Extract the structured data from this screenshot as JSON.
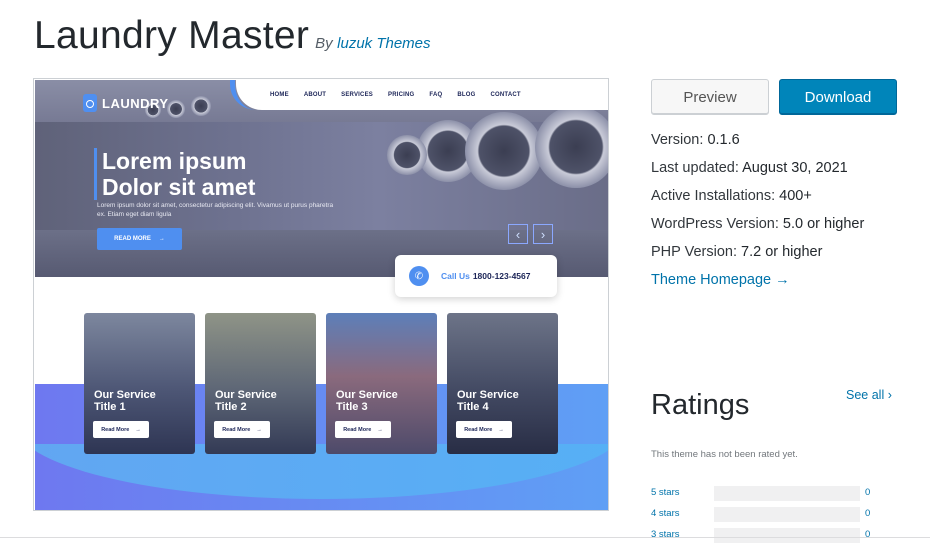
{
  "theme": {
    "name": "Laundry Master",
    "by_label": "By",
    "author": "luzuk Themes"
  },
  "screenshot": {
    "logo_text": "LAUNDRY",
    "nav": [
      "HOME",
      "ABOUT",
      "SERVICES",
      "PRICING",
      "FAQ",
      "BLOG",
      "CONTACT"
    ],
    "headline_line1": "Lorem ipsum",
    "headline_line2": "Dolor sit amet",
    "subtext": "Lorem ipsum dolor sit amet, consectetur adipiscing elit. Vivamus ut purus pharetra ex. Etiam eget diam ligula",
    "read_more": "READ MORE",
    "call_label": "Call Us",
    "call_number": "1800-123-4567",
    "services": [
      {
        "title_line1": "Our Service",
        "title_line2": "Title 1",
        "button": "Read More"
      },
      {
        "title_line1": "Our Service",
        "title_line2": "Title 2",
        "button": "Read More"
      },
      {
        "title_line1": "Our Service",
        "title_line2": "Title 3",
        "button": "Read More"
      },
      {
        "title_line1": "Our Service",
        "title_line2": "Title 4",
        "button": "Read More"
      }
    ],
    "accent_color": "#4f8ff0"
  },
  "actions": {
    "preview_label": "Preview",
    "download_label": "Download"
  },
  "meta": {
    "version_label": "Version:",
    "version_value": "0.1.6",
    "updated_label": "Last updated:",
    "updated_value": "August 30, 2021",
    "installs_label": "Active Installations:",
    "installs_value": "400+",
    "wp_label": "WordPress Version:",
    "wp_value": "5.0 or higher",
    "php_label": "PHP Version:",
    "php_value": "7.2 or higher",
    "homepage_label": "Theme Homepage →"
  },
  "ratings": {
    "title": "Ratings",
    "see_all": "See all ›",
    "empty_text": "This theme has not been rated yet.",
    "rows": [
      {
        "label": "5 stars",
        "count": "0",
        "fraction": 0
      },
      {
        "label": "4 stars",
        "count": "0",
        "fraction": 0
      },
      {
        "label": "3 stars",
        "count": "0",
        "fraction": 0
      }
    ]
  },
  "colors": {
    "link": "#0073aa",
    "download_button": "#0085ba"
  }
}
